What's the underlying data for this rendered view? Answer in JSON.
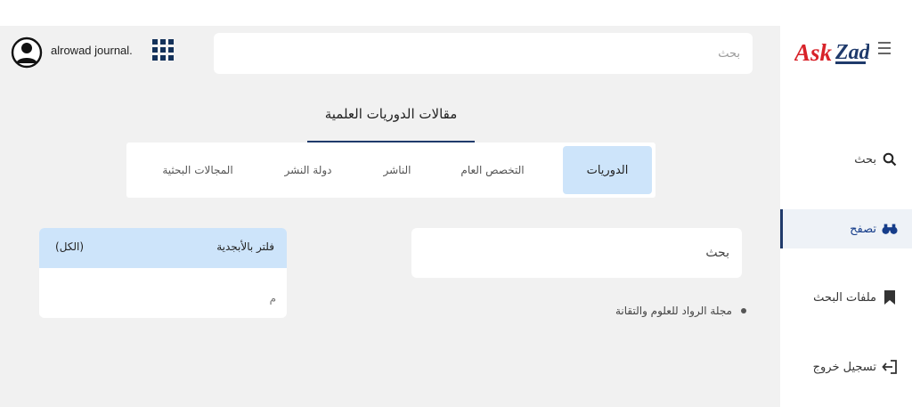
{
  "header": {
    "username": "alrowad journal.",
    "search_placeholder": "بحث"
  },
  "sidebar": {
    "logo_text": "AskZad",
    "items": [
      {
        "label": "بحث",
        "icon": "search-icon"
      },
      {
        "label": "تصفح",
        "icon": "binoculars-icon",
        "active": true
      },
      {
        "label": "ملفات البحث",
        "icon": "bookmark-icon"
      },
      {
        "label": "تسجيل خروج",
        "icon": "logout-icon"
      }
    ]
  },
  "main": {
    "title": "مقالات الدوريات العلمية",
    "tabs": [
      {
        "label": "الدوريات",
        "active": true
      },
      {
        "label": "التخصص العام"
      },
      {
        "label": "الناشر"
      },
      {
        "label": "دولة النشر"
      },
      {
        "label": "المجالات البحثية"
      }
    ],
    "search_placeholder": "بحث",
    "results": [
      {
        "label": "مجلة الرواد للعلوم والتقانة"
      }
    ],
    "filter": {
      "title": "فلتر بالأبجدية",
      "all_label": "(الكل)",
      "letters": [
        "م"
      ]
    }
  },
  "colors": {
    "brand_red": "#d8232a",
    "brand_navy": "#1f3a6b",
    "active_tab_bg": "#cde4fa",
    "page_bg": "#f1f1f1"
  }
}
